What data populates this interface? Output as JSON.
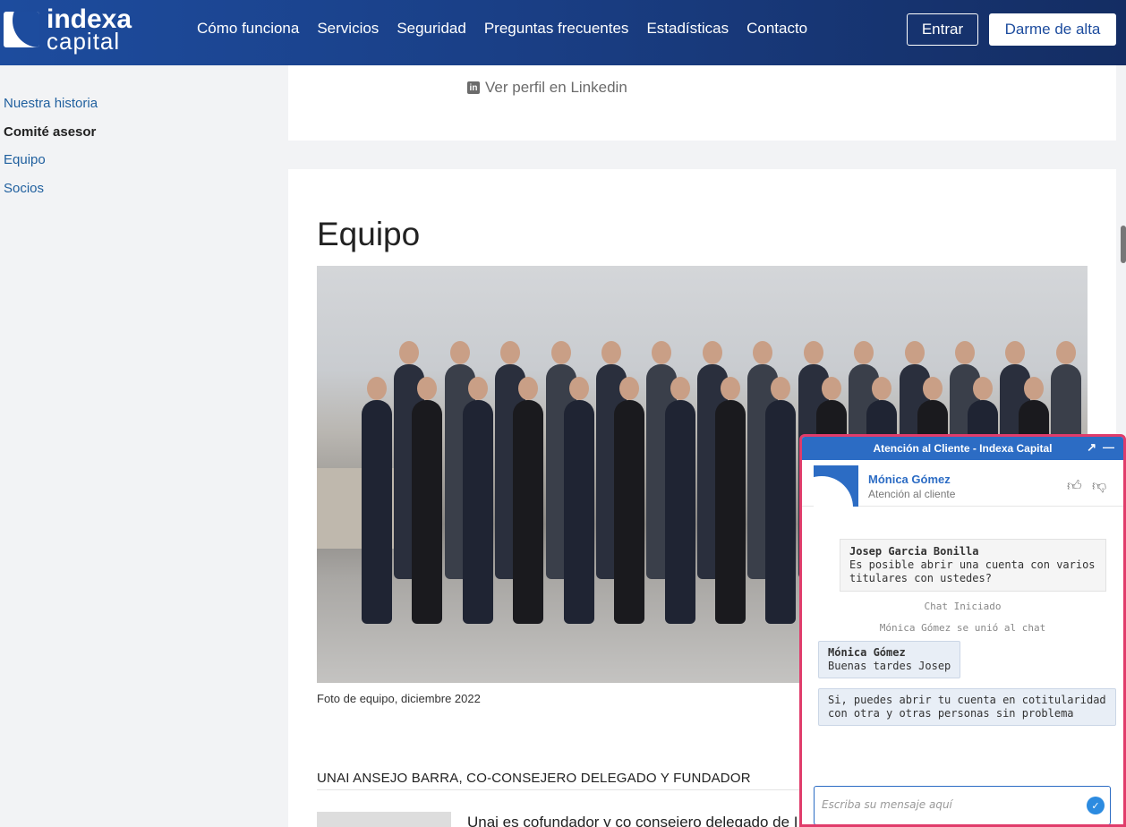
{
  "header": {
    "logo_line1": "indexa",
    "logo_line2": "capital",
    "nav": [
      "Cómo funciona",
      "Servicios",
      "Seguridad",
      "Preguntas frecuentes",
      "Estadísticas",
      "Contacto"
    ],
    "login_label": "Entrar",
    "signup_label": "Darme de alta",
    "brand_color": "#1d4c9e"
  },
  "sidebar": {
    "items": [
      {
        "label": "Nuestra historia",
        "active": false
      },
      {
        "label": "Comité asesor",
        "active": true
      },
      {
        "label": "Equipo",
        "active": false
      },
      {
        "label": "Socios",
        "active": false
      }
    ]
  },
  "content": {
    "linkedin_link": "Ver perfil en Linkedin",
    "section_title": "Equipo",
    "photo_caption": "Foto de equipo, diciembre 2022",
    "member_heading": "UNAI ANSEJO BARRA, CO-CONSEJERO DELEGADO Y FUNDADOR",
    "member_bio_start": "Unai es cofundador y co consejero delegado de I"
  },
  "chat": {
    "title": "Atención al Cliente - Indexa Capital",
    "expand_icon": "↗",
    "minimize_icon": "—",
    "agent_name": "Mónica Gómez",
    "agent_role": "Atención al cliente",
    "messages": {
      "user_name": "Josep Garcia Bonilla",
      "user_text_1": "Es posible abrir una cuenta con varios",
      "user_text_2": "titulares con ustedes?",
      "system_1": "Chat Iniciado",
      "system_2": "Mónica Gómez se unió al chat",
      "agent_name": "Mónica Gómez",
      "agent_text_1": "Buenas tardes Josep",
      "agent_text_2a": "Si, puedes abrir tu cuenta en cotitularidad",
      "agent_text_2b": "con otra y otras personas sin problema"
    },
    "input_placeholder": "Escriba su mensaje aquí",
    "accent_color": "#2c6cc4",
    "border_color": "#e03c6b"
  }
}
